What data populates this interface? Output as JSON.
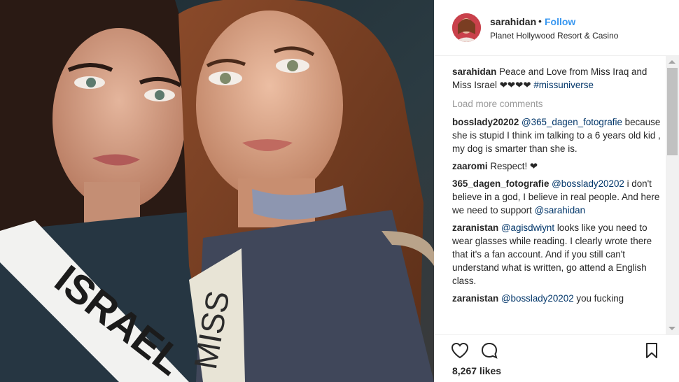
{
  "post": {
    "username": "sarahidan",
    "separator": "•",
    "follow_label": "Follow",
    "location": "Planet Hollywood Resort & Casino",
    "likes": "8,267 likes"
  },
  "photo": {
    "sash_left_text": "ISRAEL",
    "sash_right_text": "MISS"
  },
  "caption": {
    "user": "sarahidan",
    "text": " Peace and Love from Miss Iraq and Miss Israel ❤❤❤❤ ",
    "hashtag": "#missuniverse"
  },
  "load_more_label": "Load more comments",
  "comments": [
    {
      "user": "bosslady20202",
      "mention": "@365_dagen_fotografie",
      "text": " because she is stupid I think im talking to a 6 years old kid , my dog is smarter than she is."
    },
    {
      "user": "zaaromi",
      "mention": "",
      "text": " Respect! ❤"
    },
    {
      "user": "365_dagen_fotografie",
      "mention": "@bosslady20202",
      "text": " i don't believe in a god, I believe in real people. And here we need to support ",
      "mention2": "@sarahidan"
    },
    {
      "user": "zaranistan",
      "mention": "@agisdwiynt",
      "text": " looks like you need to wear glasses while reading. I clearly wrote there that it's a fan account. And if you still can't understand what is written, go attend a English class."
    },
    {
      "user": "zaranistan",
      "mention": "@bosslady20202",
      "text": " you fucking"
    }
  ],
  "colors": {
    "link": "#3897f0",
    "mention": "#003569",
    "muted": "#999999",
    "text": "#262626"
  },
  "icons": [
    "heart-icon",
    "comment-icon",
    "bookmark-icon"
  ]
}
